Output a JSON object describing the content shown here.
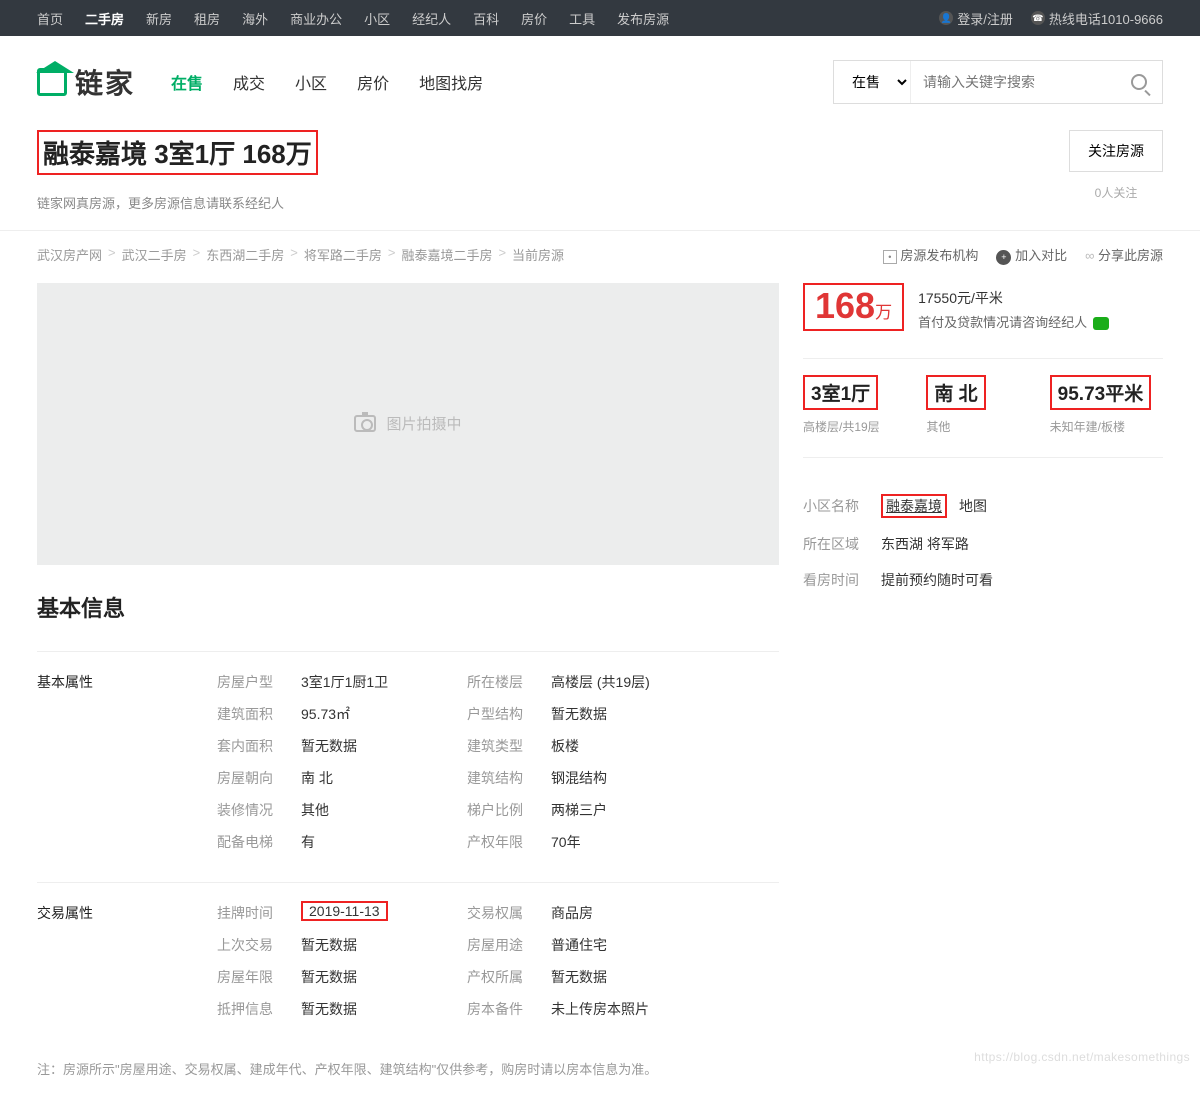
{
  "topnav": [
    "首页",
    "二手房",
    "新房",
    "租房",
    "海外",
    "商业办公",
    "小区",
    "经纪人",
    "百科",
    "房价",
    "工具",
    "发布房源"
  ],
  "topnav_active": 1,
  "top_right": {
    "login": "登录/注册",
    "hotline": "热线电话1010-9666"
  },
  "logo": {
    "text": "链家"
  },
  "nav2": [
    "在售",
    "成交",
    "小区",
    "房价",
    "地图找房"
  ],
  "nav2_active": 0,
  "search": {
    "scope": "在售",
    "placeholder": "请输入关键字搜索"
  },
  "title": "融泰嘉境 3室1厅 168万",
  "subtitle": "链家网真房源，更多房源信息请联系经纪人",
  "follow": {
    "btn": "关注房源",
    "count": "0人关注"
  },
  "breadcrumb": [
    "武汉房产网",
    "武汉二手房",
    "东西湖二手房",
    "将军路二手房",
    "融泰嘉境二手房",
    "当前房源"
  ],
  "actions": {
    "publisher": "房源发布机构",
    "compare": "加入对比",
    "share": "分享此房源"
  },
  "gallery": {
    "placeholder": "图片拍摄中"
  },
  "price": {
    "num": "168",
    "unit": "万",
    "unit_price": "17550元/平米",
    "loan": "首付及贷款情况请咨询经纪人"
  },
  "specs": [
    {
      "main": "3室1厅",
      "sub": "高楼层/共19层"
    },
    {
      "main": "南 北",
      "sub": "其他"
    },
    {
      "main": "95.73平米",
      "sub": "未知年建/板楼"
    }
  ],
  "meta": {
    "community_k": "小区名称",
    "community_v": "融泰嘉境",
    "map": "地图",
    "area_k": "所在区域",
    "area_v": "东西湖 将军路",
    "visit_k": "看房时间",
    "visit_v": "提前预约随时可看"
  },
  "section_title": "基本信息",
  "basic": {
    "title": "基本属性",
    "rows": [
      [
        [
          "房屋户型",
          "3室1厅1厨1卫"
        ],
        [
          "所在楼层",
          "高楼层 (共19层)"
        ]
      ],
      [
        [
          "建筑面积",
          "95.73㎡"
        ],
        [
          "户型结构",
          "暂无数据"
        ]
      ],
      [
        [
          "套内面积",
          "暂无数据"
        ],
        [
          "建筑类型",
          "板楼"
        ]
      ],
      [
        [
          "房屋朝向",
          "南 北"
        ],
        [
          "建筑结构",
          "钢混结构"
        ]
      ],
      [
        [
          "装修情况",
          "其他"
        ],
        [
          "梯户比例",
          "两梯三户"
        ]
      ],
      [
        [
          "配备电梯",
          "有"
        ],
        [
          "产权年限",
          "70年"
        ]
      ]
    ]
  },
  "trans": {
    "title": "交易属性",
    "rows": [
      [
        [
          "挂牌时间",
          "2019-11-13",
          true
        ],
        [
          "交易权属",
          "商品房"
        ]
      ],
      [
        [
          "上次交易",
          "暂无数据"
        ],
        [
          "房屋用途",
          "普通住宅"
        ]
      ],
      [
        [
          "房屋年限",
          "暂无数据"
        ],
        [
          "产权所属",
          "暂无数据"
        ]
      ],
      [
        [
          "抵押信息",
          "暂无数据"
        ],
        [
          "房本备件",
          "未上传房本照片"
        ]
      ]
    ]
  },
  "footnote": "注：房源所示\"房屋用途、交易权属、建成年代、产权年限、建筑结构\"仅供参考，购房时请以房本信息为准。",
  "watermark": "https://blog.csdn.net/makesomethings"
}
